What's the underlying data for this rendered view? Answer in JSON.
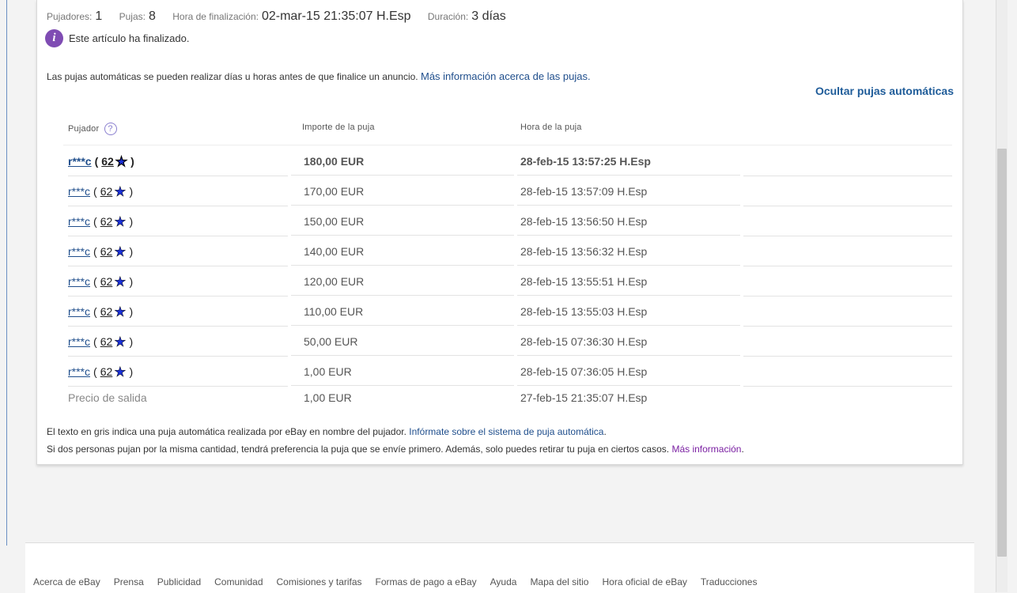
{
  "summary": {
    "bidders_label": "Pujadores:",
    "bidders_value": "1",
    "bids_label": "Pujas:",
    "bids_value": "8",
    "end_label": "Hora de finalización:",
    "end_value": "02-mar-15 21:35:07 H.Esp",
    "duration_label": "Duración:",
    "duration_value": "3 días"
  },
  "status": {
    "icon": "info-icon",
    "text": "Este artículo ha finalizado."
  },
  "auto_bids": {
    "text": "Las pujas automáticas se pueden realizar días u horas antes de que finalice un anuncio.",
    "link": "Más información acerca de las pujas.",
    "hide_link": "Ocultar pujas automáticas"
  },
  "table": {
    "headers": {
      "bidder": "Pujador",
      "amount": "Importe de la puja",
      "time": "Hora de la puja"
    },
    "rows": [
      {
        "bidder": "r***c",
        "score": "62",
        "amount": "180,00 EUR",
        "time": "28-feb-15 13:57:25 H.Esp"
      },
      {
        "bidder": "r***c",
        "score": "62",
        "amount": "170,00 EUR",
        "time": "28-feb-15 13:57:09 H.Esp"
      },
      {
        "bidder": "r***c",
        "score": "62",
        "amount": "150,00 EUR",
        "time": "28-feb-15 13:56:50 H.Esp"
      },
      {
        "bidder": "r***c",
        "score": "62",
        "amount": "140,00 EUR",
        "time": "28-feb-15 13:56:32 H.Esp"
      },
      {
        "bidder": "r***c",
        "score": "62",
        "amount": "120,00 EUR",
        "time": "28-feb-15 13:55:51 H.Esp"
      },
      {
        "bidder": "r***c",
        "score": "62",
        "amount": "110,00 EUR",
        "time": "28-feb-15 13:55:03 H.Esp"
      },
      {
        "bidder": "r***c",
        "score": "62",
        "amount": "50,00 EUR",
        "time": "28-feb-15 07:36:30 H.Esp"
      },
      {
        "bidder": "r***c",
        "score": "62",
        "amount": "1,00 EUR",
        "time": "28-feb-15 07:36:05 H.Esp"
      }
    ],
    "start_row": {
      "label": "Precio de salida",
      "amount": "1,00 EUR",
      "time": "27-feb-15 21:35:07 H.Esp"
    }
  },
  "notes": {
    "gray_text": "El texto en gris indica una puja automática realizada por eBay en nombre del pujador.",
    "gray_link": "Infórmate sobre el sistema de puja automática",
    "tie_text": "Si dos personas pujan por la misma cantidad, tendrá preferencia la puja que se envíe primero. Además, solo puedes retirar tu puja en ciertos casos.",
    "tie_link": "Más información"
  },
  "footer": {
    "links": [
      "Acerca de eBay",
      "Prensa",
      "Publicidad",
      "Comunidad",
      "Comisiones y tarifas",
      "Formas de pago a eBay",
      "Ayuda",
      "Mapa del sitio",
      "Hora oficial de eBay",
      "Traducciones"
    ]
  },
  "colors": {
    "link": "#1f4e8c",
    "visited_link": "#7a1fa2",
    "star": "#1a2fd6",
    "info_icon": "#7f4cb3"
  }
}
